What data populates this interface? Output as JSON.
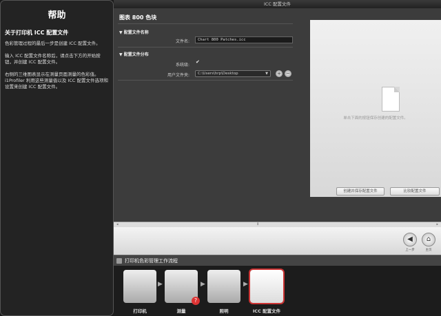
{
  "help": {
    "title": "帮助",
    "subtitle": "关于打印机 ICC 配置文件",
    "paragraphs": [
      "色彩管理过程的最后一步是创建 ICC 配置文件。",
      "输入 ICC 配置文件名称后，请点击下方的开始按钮，并创建 ICC 配置文件。",
      "右侧的三维图表显示在测量页面测量的色彩值。i1Profiler 利用这些测量值以及 ICC 配置文件选项和设置来创建 ICC 配置文件。"
    ]
  },
  "window": {
    "title": "ICC 配置文件"
  },
  "form": {
    "heading": "图表 800 色块",
    "section_name": "▼ 配置文件名称",
    "filename_label": "文件名:",
    "filename_value": "Chart 800 Patches.icc",
    "section_dist": "▼ 配置文件分布",
    "system_label": "系统级:",
    "system_checked": "✔",
    "user_folder_label": "用户文件夹:",
    "user_folder_value": "C:\\Users\\hrp\\Desktop",
    "add_symbol": "+",
    "remove_symbol": "−"
  },
  "preview": {
    "hint": "单击下面的按钮保存创建的配置文件。",
    "create_save_button": "创建并保存配置文件",
    "compare_button": "比较配置文件"
  },
  "nav": {
    "back_label": "上一步",
    "home_label": "主页",
    "back_symbol": "◀",
    "home_symbol": "⌂"
  },
  "workflow": {
    "title": "打印机色彩管理工作流程",
    "steps": [
      {
        "label": "打印机"
      },
      {
        "label": "测量"
      },
      {
        "label": "照明"
      },
      {
        "label": "ICC 配置文件"
      }
    ],
    "badge": "?"
  }
}
